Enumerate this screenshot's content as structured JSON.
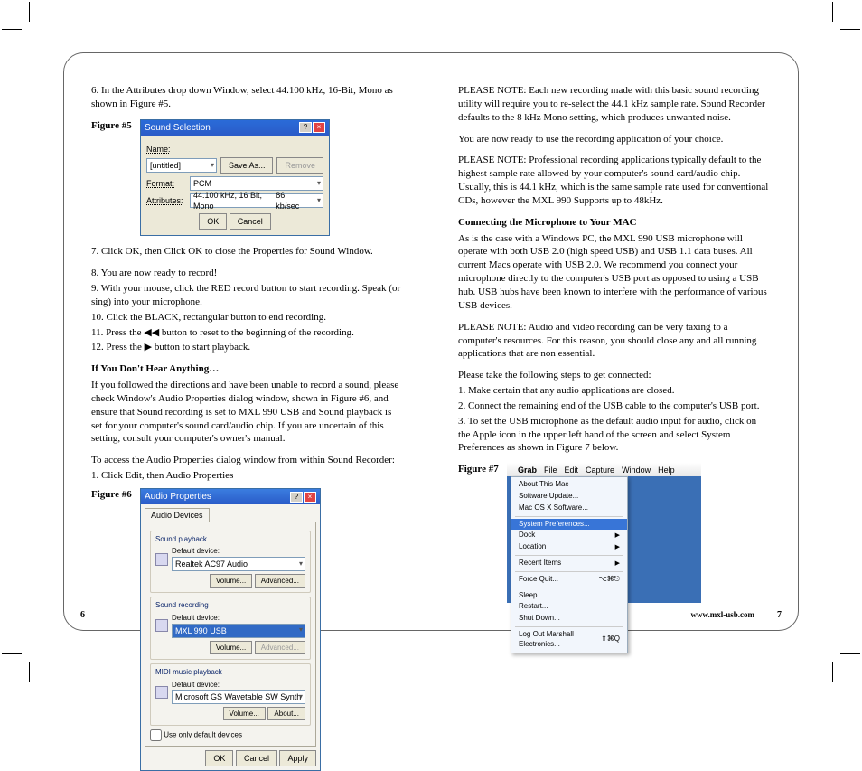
{
  "page_left": {
    "step6": "6. In the Attributes drop down Window, select 44.100 kHz, 16-Bit, Mono as shown in Figure #5.",
    "fig5_label": "Figure #5",
    "fig5": {
      "title": "Sound Selection",
      "name_label": "Name:",
      "name_value": "[untitled]",
      "saveas": "Save As...",
      "remove": "Remove",
      "format_label": "Format:",
      "format_value": "PCM",
      "attr_label": "Attributes:",
      "attr_value": "44.100 kHz, 16 Bit, Mono",
      "attr_rate": "86 kb/sec",
      "ok": "OK",
      "cancel": "Cancel"
    },
    "step7": "7. Click OK, then Click OK to close the Properties for Sound Window.",
    "step8": "8. You are now ready to record!",
    "step9": "9. With your mouse, click the RED record button to start recording. Speak (or sing) into your microphone.",
    "step10": "10. Click the BLACK, rectangular button to end recording.",
    "step11": "11. Press the ◀◀ button to reset to the beginning of the recording.",
    "step12": "12. Press the ▶ button to start playback.",
    "subhead1": "If You Don't Hear Anything…",
    "para1": "If you followed the directions and have been unable to record a sound, please check Window's Audio Properties dialog window, shown in Figure #6, and ensure that Sound recording is set to MXL 990 USB and Sound playback is set for your computer's sound card/audio chip. If you are uncertain of this setting, consult your computer's owner's manual.",
    "para2": "To access the Audio Properties dialog window from within Sound Recorder:",
    "para3": "1. Click Edit, then Audio Properties",
    "fig6_label": "Figure #6",
    "fig6": {
      "title": "Audio Properties",
      "tab": "Audio Devices",
      "g1_title": "Sound playback",
      "g1_label": "Default device:",
      "g1_value": "Realtek AC97 Audio",
      "g2_title": "Sound recording",
      "g2_label": "Default device:",
      "g2_value": "MXL 990 USB",
      "g3_title": "MIDI music playback",
      "g3_label": "Default device:",
      "g3_value": "Microsoft GS Wavetable SW Synth",
      "volume": "Volume...",
      "advanced": "Advanced...",
      "about": "About...",
      "checkbox": "Use only default devices",
      "ok": "OK",
      "cancel": "Cancel",
      "apply": "Apply"
    },
    "page_num": "6"
  },
  "page_right": {
    "note1": "PLEASE NOTE: Each new recording made with this basic sound recording utility will require you to re-select the 44.1 kHz sample rate. Sound Recorder defaults to the 8 kHz Mono setting, which produces unwanted noise.",
    "para2": "You are now ready to use the recording application of your choice.",
    "note2": "PLEASE NOTE: Professional recording applications typically default to the highest sample rate allowed by your computer's sound card/audio chip. Usually, this is 44.1 kHz, which is the same sample rate used for conventional CDs, however the MXL 990 Supports up to 48kHz.",
    "subhead1": "Connecting the Microphone to Your MAC",
    "para3": "As is the case with a Windows PC, the MXL 990 USB microphone will operate with both USB 2.0 (high speed USB) and USB 1.1 data buses. All current Macs operate with USB 2.0. We recommend you connect your microphone directly to the computer's USB port as opposed to using a USB hub. USB hubs have been known to interfere with the performance of various USB devices.",
    "note3": "PLEASE NOTE: Audio and video recording can be very taxing to a computer's resources. For this reason, you should close any and all running applications that are non essential.",
    "para4": "Please take the following steps to get connected:",
    "s1": "1. Make certain that any audio applications are closed.",
    "s2": "2. Connect the remaining end of the USB cable to the computer's USB port.",
    "s3": "3. To set the USB microphone as the default audio input for audio, click on the Apple icon in the upper left hand of the screen and select System Preferences as shown in Figure 7 below.",
    "fig7_label": "Figure #7",
    "fig7": {
      "menubar": [
        "",
        "Grab",
        "File",
        "Edit",
        "Capture",
        "Window",
        "Help"
      ],
      "items": [
        "About This Mac",
        "Software Update...",
        "Mac OS X Software...",
        "-",
        "System Preferences...",
        "Dock",
        "Location",
        "-",
        "Recent Items",
        "-",
        "Force Quit...",
        "-",
        "Sleep",
        "Restart...",
        "Shut Down...",
        "-",
        "Log Out Marshall Electronics..."
      ],
      "force_quit_short": "⌥⌘⎋",
      "logout_short": "⇧⌘Q"
    },
    "web": "www.mxl-usb.com",
    "page_num": "7"
  }
}
